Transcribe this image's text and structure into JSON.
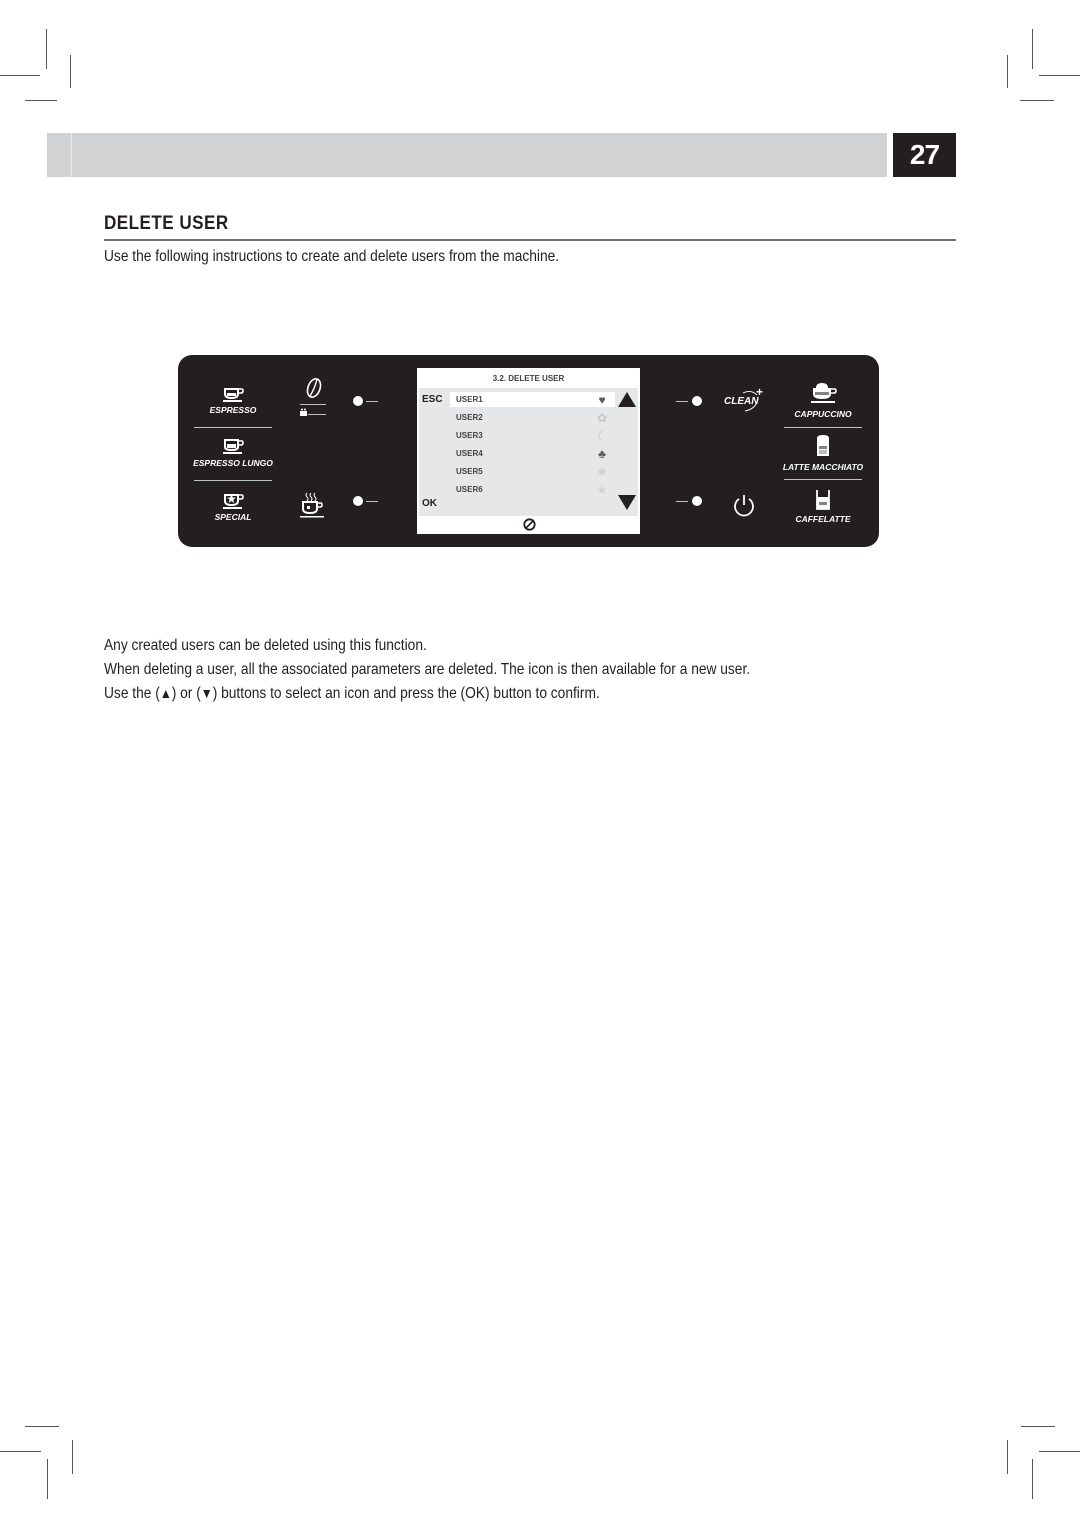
{
  "header": {
    "page_number": "27"
  },
  "section": {
    "title": "DELETE USER",
    "intro": "Use the following instructions to create and delete users from the machine."
  },
  "control_panel": {
    "left_buttons": [
      {
        "label": "ESPRESSO",
        "icon": "espresso-cup-icon"
      },
      {
        "label": "ESPRESSO LUNGO",
        "icon": "espresso-lungo-cup-icon"
      },
      {
        "label": "SPECIAL",
        "icon": "special-cup-icon"
      }
    ],
    "aroma_icon": "coffee-bean-icon",
    "ground_icon": "ground-coffee-icon",
    "hot_water_icon": "hot-water-cup-icon",
    "right_buttons": [
      {
        "label": "CAPPUCCINO",
        "icon": "cappuccino-cup-icon"
      },
      {
        "label": "LATTE MACCHIATO",
        "icon": "latte-macchiato-glass-icon"
      },
      {
        "label": "CAFFELATTE",
        "icon": "caffelatte-glass-icon"
      }
    ],
    "clean_label": "CLEAN",
    "clean_plus": "+",
    "power_icon": "power-icon",
    "display": {
      "title": "3.2. DELETE USER",
      "esc_label": "ESC",
      "ok_label": "OK",
      "selected_index": 0,
      "users": [
        {
          "label": "USER1",
          "icon": "heart-icon",
          "glyph": "♥",
          "color": "#58595b"
        },
        {
          "label": "USER2",
          "icon": "flower-icon",
          "glyph": "✿",
          "color": "#c7c8ca"
        },
        {
          "label": "USER3",
          "icon": "moon-icon",
          "glyph": "☾",
          "color": "#c7c8ca"
        },
        {
          "label": "USER4",
          "icon": "clover-icon",
          "glyph": "♣",
          "color": "#58595b"
        },
        {
          "label": "USER5",
          "icon": "sun-icon",
          "glyph": "✹",
          "color": "#d1d2d4"
        },
        {
          "label": "USER6",
          "icon": "star-icon",
          "glyph": "★",
          "color": "#d1d2d4"
        }
      ],
      "footer_icon": "coffee-bean-icon"
    }
  },
  "body": {
    "paragraph_1": "Any created users can be deleted using this function.",
    "paragraph_2": "When deleting a user, all the associated parameters are deleted. The icon is then available for a new user.",
    "paragraph_3_a": "Use the (",
    "up_symbol": "▲",
    "paragraph_3_b": ") or (",
    "down_symbol": "▼",
    "paragraph_3_c": ") buttons to select an icon and press the (OK) button to confirm."
  }
}
